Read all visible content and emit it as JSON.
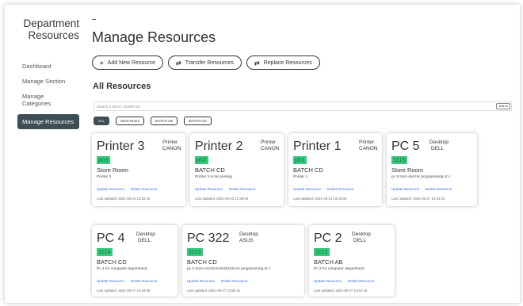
{
  "sidebar": {
    "brand_line1": "Department",
    "brand_line2": "Resources",
    "items": [
      {
        "label": "Dashboard"
      },
      {
        "label": "Manage Section"
      },
      {
        "label": "Manage Categories"
      },
      {
        "label": "Manage Resources"
      }
    ]
  },
  "header": {
    "title": "Manage Resources"
  },
  "actions": {
    "add_label": "Add New Resource",
    "transfer_label": "Transfer Resources",
    "replace_label": "Replace Resources"
  },
  "list": {
    "subtitle": "All Resources",
    "search_placeholder": "Search a SEAC ASSER IIS",
    "search_button": "search"
  },
  "filters": [
    "ALL",
    "Store Room",
    "BATCH AB",
    "BATCH CD"
  ],
  "colors": {
    "badge": "#36c97f",
    "active_nav": "#3d4f55",
    "link": "#3a6fd8"
  },
  "cards": [
    {
      "name": "Printer 3",
      "type": "Printer",
      "brand": "CANON",
      "code": "p03",
      "location": "Store Room",
      "desc": "Printer 3",
      "update": "Update Resource",
      "delete": "Delete Resource",
      "updated": "Last updated: 2021-06-23 13:25:34"
    },
    {
      "name": "Printer 2",
      "type": "Printer",
      "brand": "CANON",
      "code": "p02",
      "location": "BATCH CD",
      "desc": "Printer 2 is for printing",
      "update": "Update Resource",
      "delete": "Delete Resource",
      "updated": "Last updated: 2021-06-23 13:39:53"
    },
    {
      "name": "Printer 1",
      "type": "Printer",
      "brand": "CANON",
      "code": "p01",
      "location": "BATCH CD",
      "desc": "Printer 1",
      "update": "Update Resource",
      "delete": "Delete Resource",
      "updated": "Last updated: 2021-06-23 13:25:38"
    },
    {
      "name": "PC 5",
      "type": "Desktop",
      "brand": "DELL",
      "code": "1115",
      "location": "Store Room",
      "desc": "pc 5 from dell for programming of c",
      "update": "Update Resource",
      "delete": "Delete Resource",
      "updated": "Last updated: 2021-06-27 13:43:43"
    },
    {
      "name": "PC 4",
      "type": "Desktop",
      "brand": "DELL",
      "code": "1114",
      "location": "BATCH CD",
      "desc": "Pc 4 for computer department.",
      "update": "Update Resource",
      "delete": "Delete Resource",
      "updated": "Last updated: 2021-06-27 13:49:06"
    },
    {
      "name": "PC 322",
      "type": "Desktop",
      "brand": "ASUS",
      "code": "1113",
      "location": "BATCH CD",
      "desc": "pc 2 from ASUS/SUS/SUSS for programming of c",
      "update": "Update Resource",
      "delete": "Delete Resource",
      "updated": "Last updated: 2021-06-27 13:55:31"
    },
    {
      "name": "PC 2",
      "type": "Desktop",
      "brand": "DELL",
      "code": "1112",
      "location": "BATCH AB",
      "desc": "Pc 2 for computer department.",
      "update": "Update Resource",
      "delete": "Delete Resource",
      "updated": "Last updated: 2021-06-27 13:44:19"
    }
  ]
}
